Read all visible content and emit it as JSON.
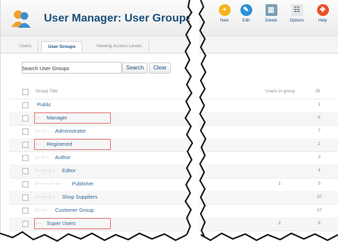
{
  "header": {
    "title": "User Manager: User Groups",
    "toolbar": [
      {
        "label": "New",
        "icon": "new-icon",
        "color": "#f4b51c"
      },
      {
        "label": "Edit",
        "icon": "edit-icon",
        "color": "#2b8fd8"
      },
      {
        "label": "Delete",
        "icon": "delete-icon",
        "color": "#7a9fb5"
      },
      {
        "label": "Options",
        "icon": "options-icon",
        "color": "#9aa5ad"
      },
      {
        "label": "Help",
        "icon": "help-icon",
        "color": "#e8502a"
      }
    ]
  },
  "tabs": [
    "Users",
    "User Groups",
    "Viewing Access Levels"
  ],
  "filter": {
    "label": "Search User Groups",
    "search_button": "Search",
    "clear_button": "Clear"
  },
  "table": {
    "col_title": "Group Title",
    "col_users": "Users in group",
    "col_id": "ID",
    "rows": [
      {
        "title": "Public",
        "indent": "",
        "users": "",
        "id": "1"
      },
      {
        "title": "Manager",
        "indent": "|—",
        "users": "",
        "id": "6"
      },
      {
        "title": "Administrator",
        "indent": "|—  |—",
        "users": "",
        "id": "7"
      },
      {
        "title": "Registered",
        "indent": "|—",
        "users": "",
        "id": "2"
      },
      {
        "title": "Author",
        "indent": "|—  |—",
        "users": "",
        "id": "3"
      },
      {
        "title": "Editor",
        "indent": "|—  |—  |—",
        "users": "",
        "id": "4"
      },
      {
        "title": "Publisher",
        "indent": "|—  |—  |—  |—",
        "users": "1",
        "id": "5"
      },
      {
        "title": "Shop Suppliers",
        "indent": "|—  |—  |—",
        "users": "",
        "id": "10"
      },
      {
        "title": "Customer Group",
        "indent": "|—  |—",
        "users": "",
        "id": "12"
      },
      {
        "title": "Super Users",
        "indent": "|—",
        "users": "2",
        "id": "8"
      }
    ]
  },
  "highlight_color": "#e07070"
}
